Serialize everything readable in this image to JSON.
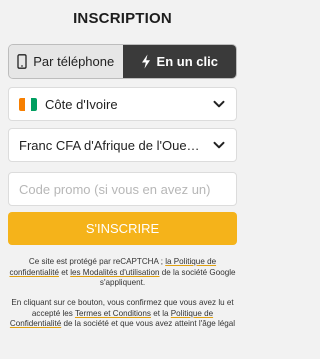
{
  "title": "INSCRIPTION",
  "tabs": {
    "phone": "Par téléphone",
    "oneclick": "En un clic"
  },
  "country": {
    "value": "Côte d'Ivoire",
    "flag_colors": [
      "#f77f00",
      "#ffffff",
      "#009e60"
    ]
  },
  "currency": {
    "value": "Franc CFA d'Afrique de l'Ouest (XOF)"
  },
  "promo": {
    "placeholder": "Code promo (si vous en avez un)"
  },
  "submit_label": "S'INSCRIRE",
  "legal1": {
    "prefix": "Ce site est protégé par reCAPTCHA ; ",
    "link1": "la Politique de confidentialité",
    "mid": " et ",
    "link2": "les Modalités d'utilisation",
    "suffix": " de la société Google s'appliquent."
  },
  "legal2": {
    "prefix": "En cliquant sur ce bouton, vous confirmez que vous avez lu et accepté les ",
    "link1": "Termes et Conditions",
    "mid": " et la ",
    "link2": "Politique de Confidentialité",
    "suffix": " de la société et que vous avez atteint l'âge légal"
  },
  "colors": {
    "accent": "#f5b31a",
    "active_tab": "#3a3a3a"
  }
}
